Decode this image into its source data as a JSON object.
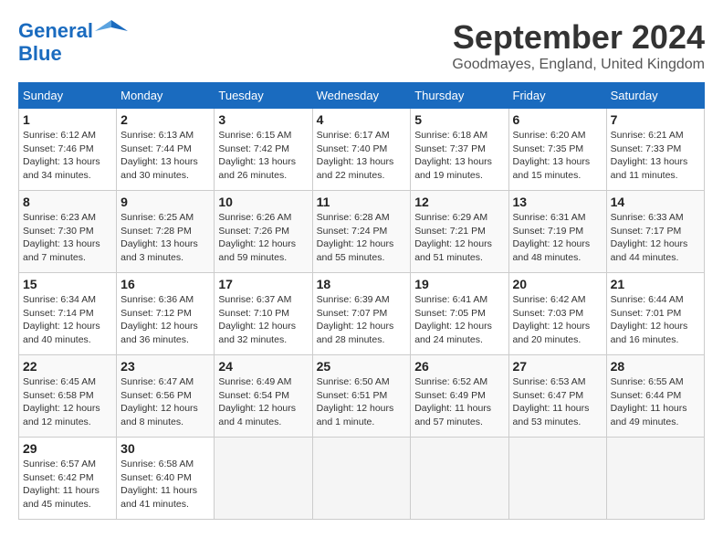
{
  "header": {
    "logo_line1": "General",
    "logo_line2": "Blue",
    "month_title": "September 2024",
    "location": "Goodmayes, England, United Kingdom"
  },
  "columns": [
    "Sunday",
    "Monday",
    "Tuesday",
    "Wednesday",
    "Thursday",
    "Friday",
    "Saturday"
  ],
  "weeks": [
    [
      {
        "day": "1",
        "info": "Sunrise: 6:12 AM\nSunset: 7:46 PM\nDaylight: 13 hours\nand 34 minutes."
      },
      {
        "day": "2",
        "info": "Sunrise: 6:13 AM\nSunset: 7:44 PM\nDaylight: 13 hours\nand 30 minutes."
      },
      {
        "day": "3",
        "info": "Sunrise: 6:15 AM\nSunset: 7:42 PM\nDaylight: 13 hours\nand 26 minutes."
      },
      {
        "day": "4",
        "info": "Sunrise: 6:17 AM\nSunset: 7:40 PM\nDaylight: 13 hours\nand 22 minutes."
      },
      {
        "day": "5",
        "info": "Sunrise: 6:18 AM\nSunset: 7:37 PM\nDaylight: 13 hours\nand 19 minutes."
      },
      {
        "day": "6",
        "info": "Sunrise: 6:20 AM\nSunset: 7:35 PM\nDaylight: 13 hours\nand 15 minutes."
      },
      {
        "day": "7",
        "info": "Sunrise: 6:21 AM\nSunset: 7:33 PM\nDaylight: 13 hours\nand 11 minutes."
      }
    ],
    [
      {
        "day": "8",
        "info": "Sunrise: 6:23 AM\nSunset: 7:30 PM\nDaylight: 13 hours\nand 7 minutes."
      },
      {
        "day": "9",
        "info": "Sunrise: 6:25 AM\nSunset: 7:28 PM\nDaylight: 13 hours\nand 3 minutes."
      },
      {
        "day": "10",
        "info": "Sunrise: 6:26 AM\nSunset: 7:26 PM\nDaylight: 12 hours\nand 59 minutes."
      },
      {
        "day": "11",
        "info": "Sunrise: 6:28 AM\nSunset: 7:24 PM\nDaylight: 12 hours\nand 55 minutes."
      },
      {
        "day": "12",
        "info": "Sunrise: 6:29 AM\nSunset: 7:21 PM\nDaylight: 12 hours\nand 51 minutes."
      },
      {
        "day": "13",
        "info": "Sunrise: 6:31 AM\nSunset: 7:19 PM\nDaylight: 12 hours\nand 48 minutes."
      },
      {
        "day": "14",
        "info": "Sunrise: 6:33 AM\nSunset: 7:17 PM\nDaylight: 12 hours\nand 44 minutes."
      }
    ],
    [
      {
        "day": "15",
        "info": "Sunrise: 6:34 AM\nSunset: 7:14 PM\nDaylight: 12 hours\nand 40 minutes."
      },
      {
        "day": "16",
        "info": "Sunrise: 6:36 AM\nSunset: 7:12 PM\nDaylight: 12 hours\nand 36 minutes."
      },
      {
        "day": "17",
        "info": "Sunrise: 6:37 AM\nSunset: 7:10 PM\nDaylight: 12 hours\nand 32 minutes."
      },
      {
        "day": "18",
        "info": "Sunrise: 6:39 AM\nSunset: 7:07 PM\nDaylight: 12 hours\nand 28 minutes."
      },
      {
        "day": "19",
        "info": "Sunrise: 6:41 AM\nSunset: 7:05 PM\nDaylight: 12 hours\nand 24 minutes."
      },
      {
        "day": "20",
        "info": "Sunrise: 6:42 AM\nSunset: 7:03 PM\nDaylight: 12 hours\nand 20 minutes."
      },
      {
        "day": "21",
        "info": "Sunrise: 6:44 AM\nSunset: 7:01 PM\nDaylight: 12 hours\nand 16 minutes."
      }
    ],
    [
      {
        "day": "22",
        "info": "Sunrise: 6:45 AM\nSunset: 6:58 PM\nDaylight: 12 hours\nand 12 minutes."
      },
      {
        "day": "23",
        "info": "Sunrise: 6:47 AM\nSunset: 6:56 PM\nDaylight: 12 hours\nand 8 minutes."
      },
      {
        "day": "24",
        "info": "Sunrise: 6:49 AM\nSunset: 6:54 PM\nDaylight: 12 hours\nand 4 minutes."
      },
      {
        "day": "25",
        "info": "Sunrise: 6:50 AM\nSunset: 6:51 PM\nDaylight: 12 hours\nand 1 minute."
      },
      {
        "day": "26",
        "info": "Sunrise: 6:52 AM\nSunset: 6:49 PM\nDaylight: 11 hours\nand 57 minutes."
      },
      {
        "day": "27",
        "info": "Sunrise: 6:53 AM\nSunset: 6:47 PM\nDaylight: 11 hours\nand 53 minutes."
      },
      {
        "day": "28",
        "info": "Sunrise: 6:55 AM\nSunset: 6:44 PM\nDaylight: 11 hours\nand 49 minutes."
      }
    ],
    [
      {
        "day": "29",
        "info": "Sunrise: 6:57 AM\nSunset: 6:42 PM\nDaylight: 11 hours\nand 45 minutes."
      },
      {
        "day": "30",
        "info": "Sunrise: 6:58 AM\nSunset: 6:40 PM\nDaylight: 11 hours\nand 41 minutes."
      },
      {
        "day": "",
        "info": ""
      },
      {
        "day": "",
        "info": ""
      },
      {
        "day": "",
        "info": ""
      },
      {
        "day": "",
        "info": ""
      },
      {
        "day": "",
        "info": ""
      }
    ]
  ]
}
